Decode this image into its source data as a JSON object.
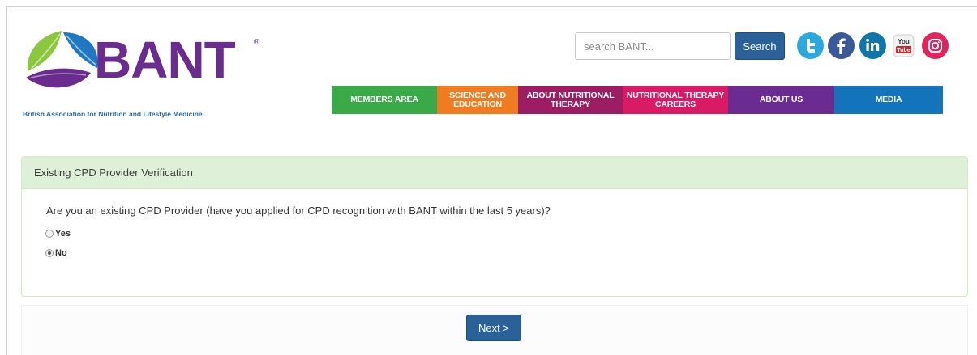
{
  "brand": {
    "wordmark": "BANT",
    "registered": "®",
    "tagline": "British Association for Nutrition and Lifestyle Medicine",
    "color": "#6b2c8f",
    "tagline_color": "#2a6aa8"
  },
  "search": {
    "placeholder": "search BANT...",
    "button_label": "Search",
    "button_color": "#2b6199"
  },
  "social": [
    {
      "name": "twitter-icon",
      "glyph": "t",
      "color": "#2aa9e0"
    },
    {
      "name": "facebook-icon",
      "glyph": "f",
      "color": "#3b5998"
    },
    {
      "name": "linkedin-icon",
      "glyph": "in",
      "color": "#0e76a8"
    },
    {
      "name": "youtube-icon",
      "glyph": "You Tube",
      "color": "#ffffff"
    },
    {
      "name": "instagram-icon",
      "glyph": "◎",
      "color": "#e0245e"
    }
  ],
  "nav": [
    {
      "label": "MEMBERS AREA",
      "color": "#3aaa48",
      "width": 130
    },
    {
      "label": "SCIENCE AND EDUCATION",
      "color": "#f07c22",
      "width": 100
    },
    {
      "label": "ABOUT NUTRITIONAL THERAPY",
      "color": "#9b1e63",
      "width": 129
    },
    {
      "label": "NUTRITIONAL THERAPY CAREERS",
      "color": "#d81b64",
      "width": 130
    },
    {
      "label": "ABOUT US",
      "color": "#6a2c91",
      "width": 131
    },
    {
      "label": "MEDIA",
      "color": "#1474bb",
      "width": 134
    }
  ],
  "panel": {
    "heading": "Existing CPD Provider Verification",
    "question": "Are you an existing CPD Provider (have you applied for CPD recognition with BANT within the last 5 years)?",
    "options": [
      {
        "label": "Yes",
        "checked": false
      },
      {
        "label": "No",
        "checked": true
      }
    ]
  },
  "footer": {
    "next_label": "Next >",
    "next_color": "#2b6199"
  }
}
